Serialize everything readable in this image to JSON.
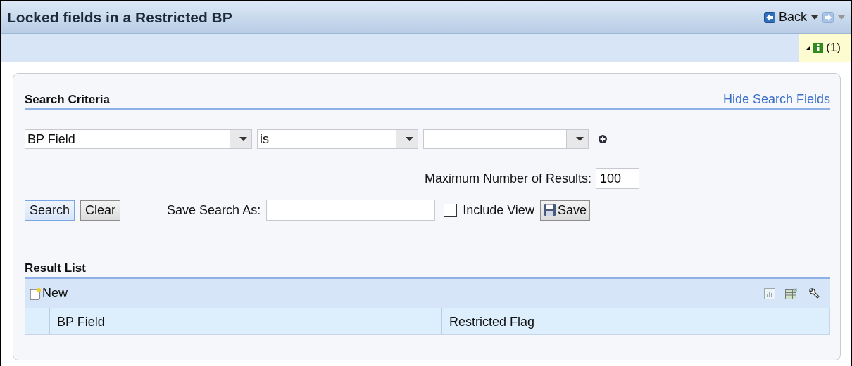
{
  "window": {
    "title": "Locked fields in a Restricted BP"
  },
  "nav": {
    "back": "Back"
  },
  "messages": {
    "count": "(1)"
  },
  "search_criteria": {
    "title": "Search Criteria",
    "toggle_link": "Hide Search Fields",
    "conditions": [
      {
        "field": "BP Field",
        "operator": "is"
      }
    ],
    "max_results_label": "Maximum Number of Results:",
    "max_results": "100",
    "buttons": [
      "Search",
      "Clear"
    ],
    "save_as_label": "Save Search As:",
    "include_view": {
      "label": "Include View",
      "checked": false
    },
    "save_button": "Save"
  },
  "result_list": {
    "title": "Result List",
    "new_button": "New",
    "columns": [
      "BP Field",
      "Restricted Flag"
    ]
  }
}
